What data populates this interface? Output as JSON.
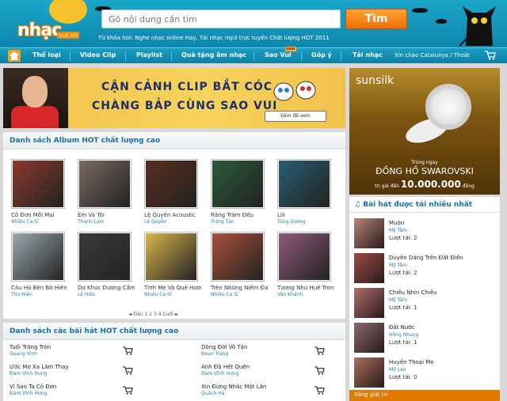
{
  "header": {
    "logo_text": "nhạc",
    "logo_domain": "vui.vn",
    "search_placeholder": "Gõ nội dung cần tìm",
    "search_button": "Tìm",
    "hot_keywords": "Từ khóa hot: Nghe nhạc online Hay, Tải nhạc mp3 trực tuyến Chất lượng HOT 2011"
  },
  "nav": {
    "items": [
      "Thể loại",
      "Video Clip",
      "Playlist",
      "Quà tặng âm nhạc",
      "Sao Vui",
      "Góp ý",
      "Tải nhạc"
    ],
    "new_badge": "new",
    "user_text": "Xin chào Catalunya / Thoát"
  },
  "banner": {
    "line1": "CẬN CẢNH CLIP BẮT CÓC",
    "line2": "CHÀNG BẢP CÙNG SAO VUI",
    "cta": "bấm để xem"
  },
  "albums": {
    "title": "Danh sách Album HOT chất lượng cao",
    "items": [
      {
        "title": "Cô Đơn Mỗi Mai",
        "artist": "Nhiều Ca Sĩ",
        "color": "#8b3a2a"
      },
      {
        "title": "Em Và Tôi",
        "artist": "Thanh Lam",
        "color": "#7a6a62"
      },
      {
        "title": "Lệ Quyên Acoustic",
        "artist": "Lệ Quyên",
        "color": "#5a2e1e"
      },
      {
        "title": "Rằng Trăm Đều",
        "artist": "Trọng Tấn",
        "color": "#2c5a3a"
      },
      {
        "title": "Lili",
        "artist": "Tùng Dương",
        "color": "#2a5d72"
      },
      {
        "title": "Câu Hò Bên Bờ Hiền Lương",
        "artist": "Thu Hiền",
        "color": "#9aa8b0"
      },
      {
        "title": "Dư Khúc Dương Cầm (Chiều...",
        "artist": "Lê Hiếu",
        "color": "#3a3a3a"
      },
      {
        "title": "Tình Mẹ Và Quê Hương",
        "artist": "Nhiều Ca Sĩ",
        "color": "#d8b44a"
      },
      {
        "title": "Trên Những Niềm Đau",
        "artist": "Nhiều Ca Sĩ",
        "color": "#a8503a"
      },
      {
        "title": "Tương Như Huế Trong Lòng",
        "artist": "Vân Khánh",
        "color": "#8e5a7a"
      }
    ],
    "pager": "◄ Đầu   1   2   3   4   Cuối ►"
  },
  "songs": {
    "title": "Danh sách các bài hát HOT chất lượng cao",
    "items": [
      {
        "name": "Tuổi Trăng Tròn",
        "singer": "Quang Vinh"
      },
      {
        "name": "Dòng Đời Vô Tận",
        "singer": "Đoan Trang"
      },
      {
        "name": "Ước Mơ Xa Lâm Thay",
        "singer": "Đàm Vĩnh Hưng"
      },
      {
        "name": "Anh Đã Hết Quên",
        "singer": "Đàm Vĩnh Hưng"
      },
      {
        "name": "Vì Sao Ta Cô Đơn",
        "singer": "Đàm Vĩnh Hưng"
      },
      {
        "name": "Xin Đừng Nhấc Một Lần",
        "singer": "Quách Hà"
      }
    ]
  },
  "ad": {
    "brand": "sunsilk",
    "line1": "Trúng ngay",
    "line2": "ĐỒNG HỒ SWAROVSKI",
    "line3_prefix": "trị giá đến",
    "line3_value": "10.000.000",
    "line3_suffix": "đồng"
  },
  "top_downloads": {
    "title": "Bài hát được tải nhiều nhất",
    "items": [
      {
        "title": "Muộn",
        "artist": "Mỹ Tâm",
        "count": "Lượt tải: 2",
        "color": "#b7857a"
      },
      {
        "title": "Duyên Dáng Trên Đất Điền",
        "artist": "Mỹ Tâm",
        "count": "Lượt tải: 2",
        "color": "#9d4b44"
      },
      {
        "title": "Chiều Nhìn Chiều",
        "artist": "Mỹ Tâm",
        "count": "Lượt tải: 1",
        "color": "#b06e6a"
      },
      {
        "title": "Đất Nước",
        "artist": "Hồng Nhung",
        "count": "Lượt tải: 1",
        "color": "#8a6a70"
      },
      {
        "title": "Huyền Thoại Mẹ",
        "artist": "Mỹ Lan",
        "count": "Lượt tải: 0",
        "color": "#a76f5a"
      }
    ]
  },
  "bottom_ad": "Sống giải trí"
}
